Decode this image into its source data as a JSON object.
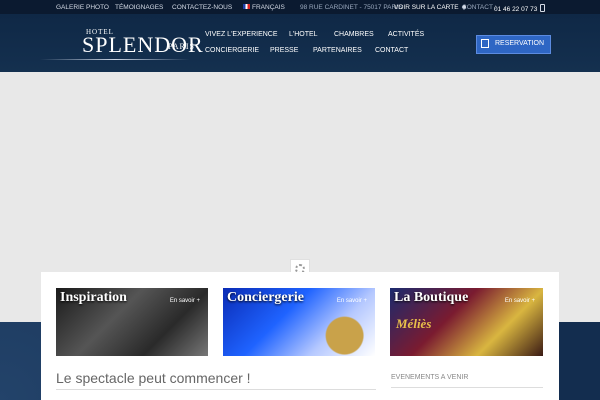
{
  "topbar": {
    "links": [
      "GALERIE PHOTO",
      "TÉMOIGNAGES",
      "CONTACTEZ-NOUS"
    ],
    "language": "FRANÇAIS",
    "address": "98 RUE CARDINET - 75017 PARIS",
    "map_link": "VOIR SUR LA CARTE",
    "contact_label": "CONTACT :",
    "phone": "01 46 22 07 73"
  },
  "logo": {
    "top": "HOTEL",
    "main": "SPLENDOR",
    "sub": "PARIS"
  },
  "nav": {
    "row1": [
      "VIVEZ L'EXPERIENCE",
      "L'HOTEL",
      "CHAMBRES",
      "ACTIVITÉS"
    ],
    "row2": [
      "CONCIERGERIE",
      "PRESSE",
      "PARTENAIRES",
      "CONTACT"
    ]
  },
  "reservation": {
    "label": "RESERVATION"
  },
  "cards": [
    {
      "title": "Inspiration",
      "more": "En savoir +"
    },
    {
      "title": "Conciergerie",
      "more": "En savoir +"
    },
    {
      "title": "La Boutique",
      "more": "En savoir +",
      "sign": "Méliès"
    }
  ],
  "tagline": "Le spectacle peut commencer !",
  "events_title": "EVENEMENTS A VENIR"
}
